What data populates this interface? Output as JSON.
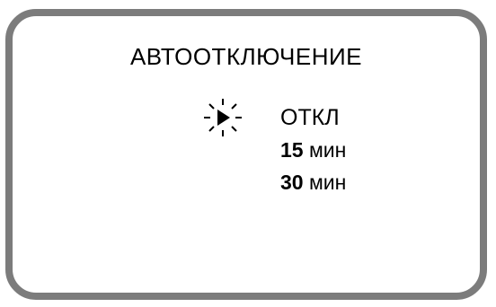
{
  "screen": {
    "title": "АВТООТКЛЮЧЕНИЕ",
    "selected_index": 0,
    "cursor_icon": "blinking-selection-arrow",
    "items": [
      {
        "label": "ОТКЛ"
      },
      {
        "number": "15",
        "unit": "мин"
      },
      {
        "number": "30",
        "unit": "мин"
      }
    ]
  },
  "colors": {
    "frame": "#7c7c7c",
    "text": "#000000",
    "background": "#ffffff"
  }
}
